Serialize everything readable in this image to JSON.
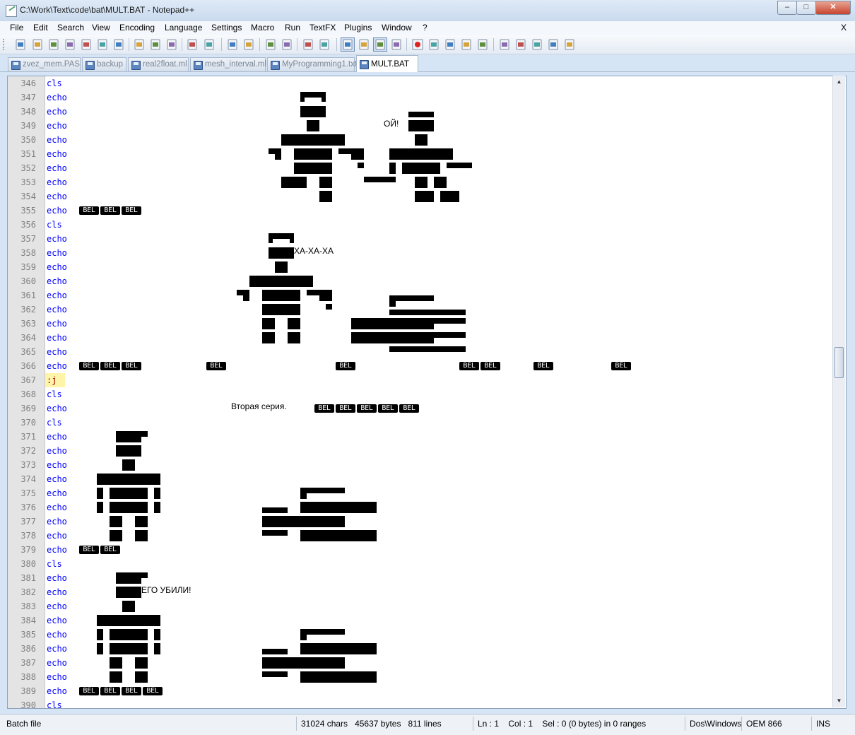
{
  "window": {
    "title": "C:\\Work\\Text\\code\\bat\\MULT.BAT - Notepad++",
    "buttons": [
      "minimize",
      "maximize",
      "close"
    ]
  },
  "menu": {
    "items": [
      "File",
      "Edit",
      "Search",
      "View",
      "Encoding",
      "Language",
      "Settings",
      "Macro",
      "Run",
      "TextFX",
      "Plugins",
      "Window",
      "?"
    ],
    "close_label": "X"
  },
  "toolbar": {
    "icons": [
      "new-file-icon",
      "open-file-icon",
      "save-icon",
      "save-all-icon",
      "close-icon",
      "close-all-icon",
      "print-icon",
      "cut-icon",
      "copy-icon",
      "paste-icon",
      "undo-icon",
      "redo-icon",
      "find-icon",
      "replace-icon",
      "zoom-in-icon",
      "zoom-out-icon",
      "sync-v-icon",
      "sync-h-icon",
      "word-wrap-icon",
      "show-all-chars-icon",
      "indent-guide-icon",
      "doc-map-icon",
      "record-macro-icon",
      "stop-macro-icon",
      "play-macro-icon",
      "run-macro-multiple-icon",
      "save-macro-icon",
      "fold-all-icon",
      "prev-bookmark-icon",
      "next-bookmark-icon",
      "clear-bookmarks-icon",
      "spellcheck-icon"
    ]
  },
  "tabs": [
    {
      "label": "zvez_mem.PAS",
      "active": false
    },
    {
      "label": "backup",
      "active": false
    },
    {
      "label": "real2float.ml",
      "active": false
    },
    {
      "label": "mesh_interval.ml",
      "active": false
    },
    {
      "label": "MyProgramming1.txt",
      "active": false
    },
    {
      "label": "MULT.BAT",
      "active": true
    }
  ],
  "editor": {
    "bel_token": "BEL",
    "texts": {
      "oi": "ОЙ!",
      "haha": "ХА-ХА-ХА",
      "second": "Вторая серия.",
      "killed": "ЕГО УБИЛИ!"
    },
    "lines": [
      {
        "n": "346",
        "cmd": "cls"
      },
      {
        "n": "347",
        "cmd": "echo"
      },
      {
        "n": "348",
        "cmd": "echo"
      },
      {
        "n": "349",
        "cmd": "echo"
      },
      {
        "n": "350",
        "cmd": "echo"
      },
      {
        "n": "351",
        "cmd": "echo"
      },
      {
        "n": "352",
        "cmd": "echo"
      },
      {
        "n": "353",
        "cmd": "echo"
      },
      {
        "n": "354",
        "cmd": "echo"
      },
      {
        "n": "355",
        "cmd": "echo"
      },
      {
        "n": "356",
        "cmd": "cls"
      },
      {
        "n": "357",
        "cmd": "echo"
      },
      {
        "n": "358",
        "cmd": "echo"
      },
      {
        "n": "359",
        "cmd": "echo"
      },
      {
        "n": "360",
        "cmd": "echo"
      },
      {
        "n": "361",
        "cmd": "echo"
      },
      {
        "n": "362",
        "cmd": "echo"
      },
      {
        "n": "363",
        "cmd": "echo"
      },
      {
        "n": "364",
        "cmd": "echo"
      },
      {
        "n": "365",
        "cmd": "echo"
      },
      {
        "n": "366",
        "cmd": "echo"
      },
      {
        "n": "367",
        "cmd": ":j"
      },
      {
        "n": "368",
        "cmd": "cls"
      },
      {
        "n": "369",
        "cmd": "echo"
      },
      {
        "n": "370",
        "cmd": "cls"
      },
      {
        "n": "371",
        "cmd": "echo"
      },
      {
        "n": "372",
        "cmd": "echo"
      },
      {
        "n": "373",
        "cmd": "echo"
      },
      {
        "n": "374",
        "cmd": "echo"
      },
      {
        "n": "375",
        "cmd": "echo"
      },
      {
        "n": "376",
        "cmd": "echo"
      },
      {
        "n": "377",
        "cmd": "echo"
      },
      {
        "n": "378",
        "cmd": "echo"
      },
      {
        "n": "379",
        "cmd": "echo"
      },
      {
        "n": "380",
        "cmd": "cls"
      },
      {
        "n": "381",
        "cmd": "echo"
      },
      {
        "n": "382",
        "cmd": "echo"
      },
      {
        "n": "383",
        "cmd": "echo"
      },
      {
        "n": "384",
        "cmd": "echo"
      },
      {
        "n": "385",
        "cmd": "echo"
      },
      {
        "n": "386",
        "cmd": "echo"
      },
      {
        "n": "387",
        "cmd": "echo"
      },
      {
        "n": "388",
        "cmd": "echo"
      },
      {
        "n": "389",
        "cmd": "echo"
      },
      {
        "n": "390",
        "cmd": "cls"
      }
    ]
  },
  "status": {
    "lang": "Batch file",
    "chars": "31024 chars",
    "bytes": "45637 bytes",
    "lines": "811 lines",
    "ln": "Ln : 1",
    "col": "Col : 1",
    "sel": "Sel : 0 (0 bytes) in 0 ranges",
    "eol": "Dos\\Windows",
    "enc": "OEM 866",
    "mode": "INS"
  }
}
